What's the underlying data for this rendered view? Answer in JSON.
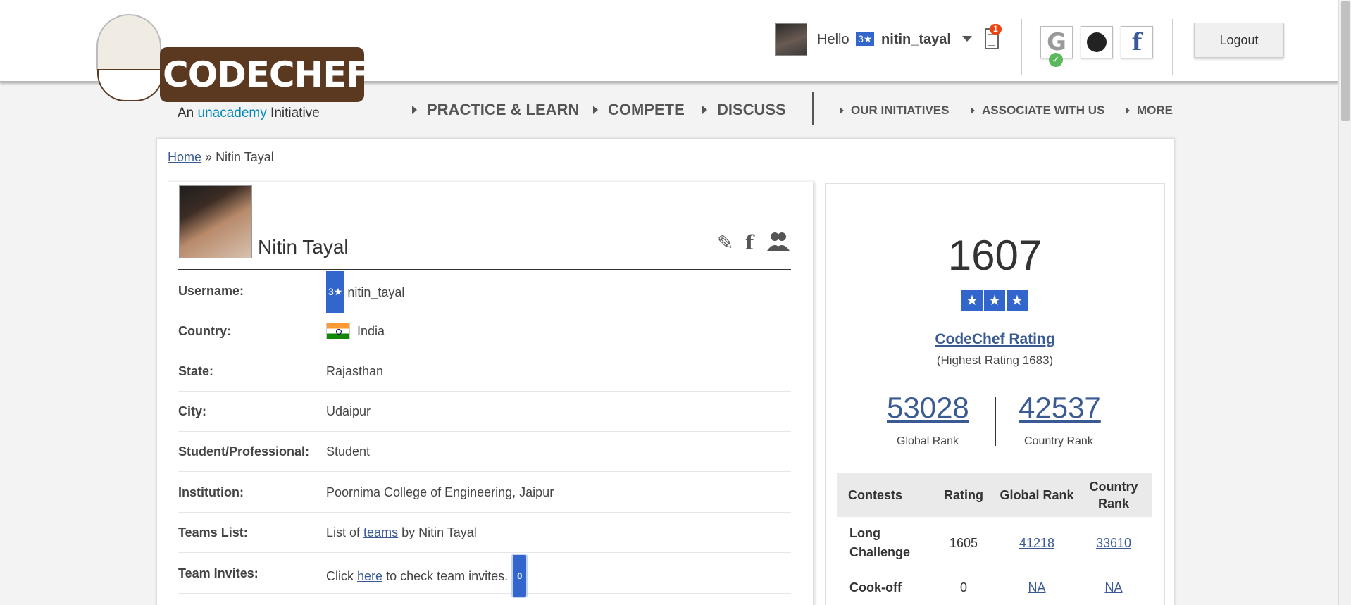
{
  "brand": {
    "logo_text": "CODECHEF",
    "tag_prefix": "An",
    "tag_partner": "unacademy",
    "tag_suffix": "Initiative"
  },
  "header": {
    "greeting": "Hello",
    "star_badge": "3★",
    "username": "nitin_tayal",
    "notification_count": "1",
    "logout_label": "Logout"
  },
  "nav": {
    "main": [
      "PRACTICE & LEARN",
      "COMPETE",
      "DISCUSS"
    ],
    "sub": [
      "OUR INITIATIVES",
      "ASSOCIATE WITH US",
      "MORE"
    ]
  },
  "breadcrumb": {
    "home": "Home",
    "separator": "»",
    "current": "Nitin Tayal"
  },
  "profile": {
    "name": "Nitin Tayal",
    "rows": [
      {
        "label": "Username:",
        "badge": "3★",
        "value": "nitin_tayal"
      },
      {
        "label": "Country:",
        "value": "India"
      },
      {
        "label": "State:",
        "value": "Rajasthan"
      },
      {
        "label": "City:",
        "value": "Udaipur"
      },
      {
        "label": "Student/Professional:",
        "value": "Student"
      },
      {
        "label": "Institution:",
        "value": "Poornima College of Engineering, Jaipur"
      },
      {
        "label": "Teams List:",
        "pre": "List of",
        "link": "teams",
        "post": "by Nitin Tayal"
      },
      {
        "label": "Team Invites:",
        "pre": "Click",
        "link": "here",
        "post": "to check team invites.",
        "badge": "0"
      }
    ]
  },
  "rating_panel": {
    "rating": "1607",
    "stars": [
      "★",
      "★",
      "★"
    ],
    "title": "CodeChef Rating",
    "highest": "(Highest Rating 1683)",
    "global_rank": "53028",
    "global_rank_label": "Global Rank",
    "country_rank": "42537",
    "country_rank_label": "Country Rank",
    "table": {
      "headers": [
        "Contests",
        "Rating",
        "Global Rank",
        "Country Rank"
      ],
      "rows": [
        {
          "contest": "Long Challenge",
          "rating": "1605",
          "global": "41218",
          "country": "33610"
        },
        {
          "contest": "Cook-off",
          "rating": "0",
          "global": "NA",
          "country": "NA"
        }
      ]
    }
  }
}
